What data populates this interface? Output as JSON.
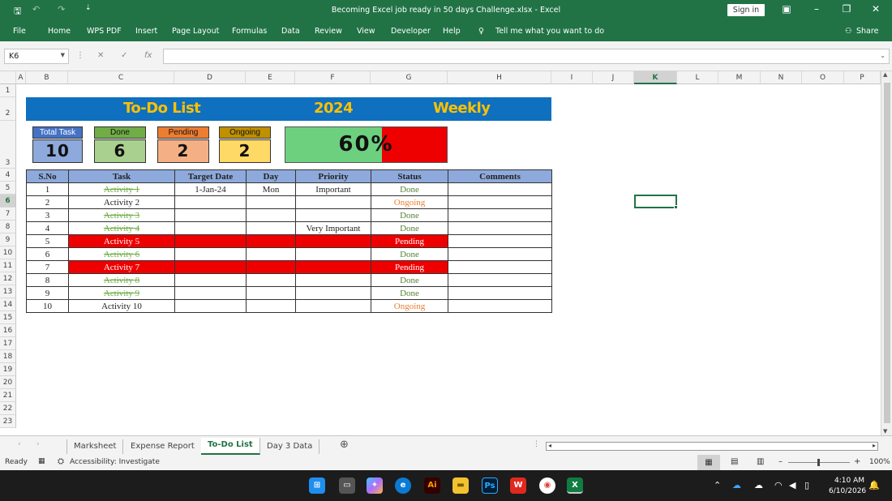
{
  "window": {
    "title": "Becoming Excel job ready in 50  days Challenge.xlsx  -  Excel",
    "signin": "Sign in"
  },
  "ribbon": {
    "tabs": [
      "File",
      "Home",
      "WPS PDF",
      "Insert",
      "Page Layout",
      "Formulas",
      "Data",
      "Review",
      "View",
      "Developer",
      "Help"
    ],
    "tell_me": "Tell me what you want to do",
    "share": "Share"
  },
  "formula_bar": {
    "name_box": "K6",
    "formula": ""
  },
  "columns": [
    "A",
    "B",
    "C",
    "D",
    "E",
    "F",
    "G",
    "H",
    "I",
    "J",
    "K",
    "L",
    "M",
    "N",
    "O",
    "P"
  ],
  "rows": [
    "1",
    "2",
    "3",
    "4",
    "5",
    "6",
    "7",
    "8",
    "9",
    "10",
    "11",
    "12",
    "13",
    "14",
    "15",
    "16",
    "17",
    "18",
    "19",
    "20",
    "21",
    "22",
    "23"
  ],
  "banner": {
    "title": "To-Do List",
    "year": "2024",
    "period": "Weekly"
  },
  "summary": {
    "total_label": "Total Task",
    "total": "10",
    "done_label": "Done",
    "done": "6",
    "pending_label": "Pending",
    "pending": "2",
    "ongoing_label": "Ongoing",
    "ongoing": "2",
    "percent": "60%",
    "progress": 0.6
  },
  "table": {
    "headers": [
      "S.No",
      "Task",
      "Target Date",
      "Day",
      "Priority",
      "Status",
      "Comments"
    ],
    "rows": [
      {
        "sno": "1",
        "task": "Activity 1",
        "date": "1-Jan-24",
        "day": "Mon",
        "priority": "Important",
        "status": "Done"
      },
      {
        "sno": "2",
        "task": "Activity 2",
        "date": "",
        "day": "",
        "priority": "",
        "status": "Ongoing"
      },
      {
        "sno": "3",
        "task": "Activity 3",
        "date": "",
        "day": "",
        "priority": "",
        "status": "Done"
      },
      {
        "sno": "4",
        "task": "Activity 4",
        "date": "",
        "day": "",
        "priority": "Very Important",
        "status": "Done"
      },
      {
        "sno": "5",
        "task": "Activity 5",
        "date": "",
        "day": "",
        "priority": "",
        "status": "Pending"
      },
      {
        "sno": "6",
        "task": "Activity 6",
        "date": "",
        "day": "",
        "priority": "",
        "status": "Done"
      },
      {
        "sno": "7",
        "task": "Activity 7",
        "date": "",
        "day": "",
        "priority": "",
        "status": "Pending"
      },
      {
        "sno": "8",
        "task": "Activity 8",
        "date": "",
        "day": "",
        "priority": "",
        "status": "Done"
      },
      {
        "sno": "9",
        "task": "Activity 9",
        "date": "",
        "day": "",
        "priority": "",
        "status": "Done"
      },
      {
        "sno": "10",
        "task": "Activity 10",
        "date": "",
        "day": "",
        "priority": "",
        "status": "Ongoing"
      }
    ]
  },
  "sheets": [
    "Marksheet",
    "Expense Report",
    "To-Do List",
    "Day 3 Data"
  ],
  "status": {
    "ready": "Ready",
    "accessibility": "Accessibility: Investigate",
    "zoom": "100%"
  },
  "clock": {
    "time": "4:10 AM",
    "date": "6/10/2026"
  }
}
